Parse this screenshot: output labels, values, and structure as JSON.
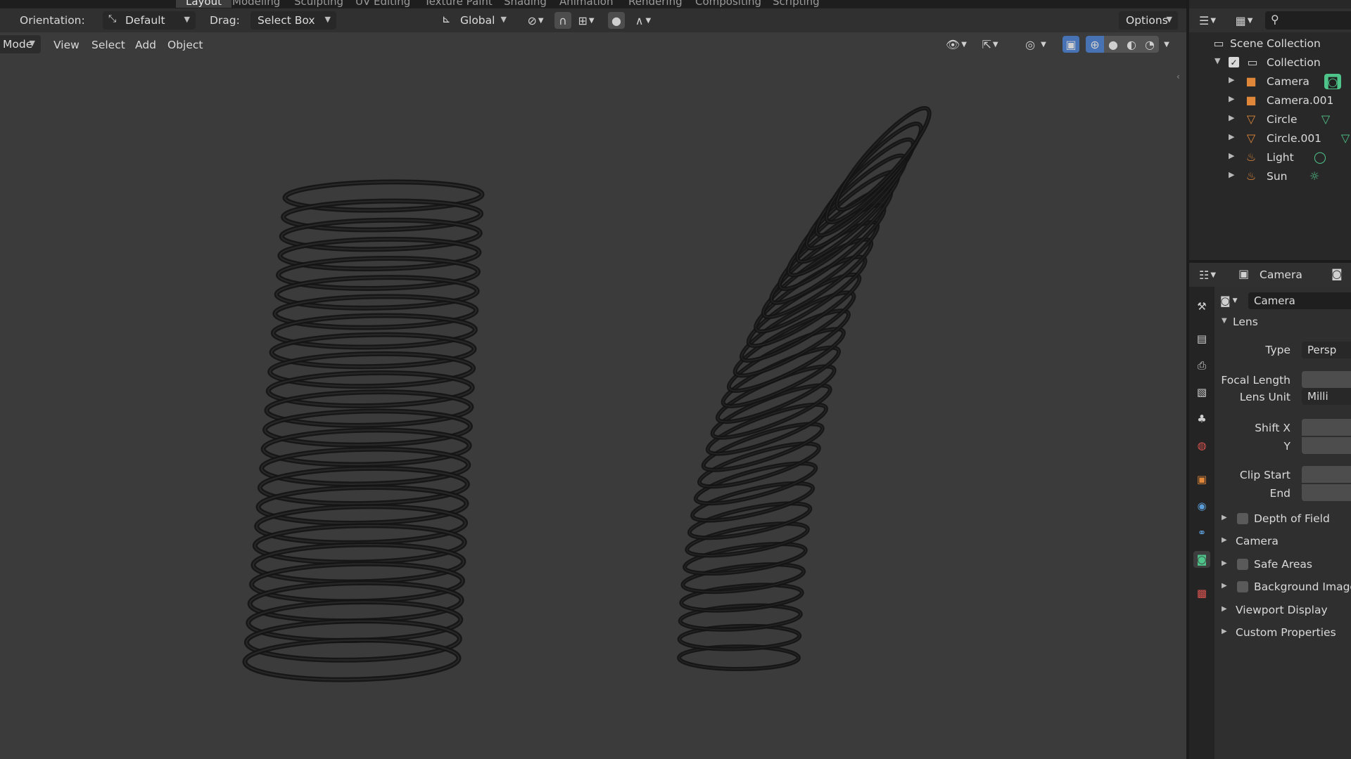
{
  "workspace_tabs": [
    "Layout",
    "Modeling",
    "Sculpting",
    "UV Editing",
    "Texture Paint",
    "Shading",
    "Animation",
    "Rendering",
    "Compositing",
    "Scripting"
  ],
  "tool_header": {
    "orientation_label": "Orientation:",
    "orientation_value": "Default",
    "drag_label": "Drag:",
    "drag_value": "Select Box",
    "transform_orientation": "Global",
    "options_label": "Options"
  },
  "viewport_header": {
    "mode_label": "Mode",
    "menus": [
      "View",
      "Select",
      "Add",
      "Object"
    ]
  },
  "outliner": {
    "root": "Scene Collection",
    "collection": "Collection",
    "items": [
      {
        "name": "Camera",
        "type": "camera"
      },
      {
        "name": "Camera.001",
        "type": "camera"
      },
      {
        "name": "Circle",
        "type": "curve"
      },
      {
        "name": "Circle.001",
        "type": "curve"
      },
      {
        "name": "Light",
        "type": "light"
      },
      {
        "name": "Sun",
        "type": "light"
      }
    ]
  },
  "properties": {
    "header_object": "Camera",
    "data_name": "Camera",
    "lens_section": "Lens",
    "fields": {
      "type_label": "Type",
      "type_value": "Persp",
      "focal_length_label": "Focal Length",
      "lens_unit_label": "Lens Unit",
      "lens_unit_value": "Milli",
      "shift_x_label": "Shift X",
      "shift_y_label": "Y",
      "clip_start_label": "Clip Start",
      "clip_end_label": "End"
    },
    "sections": [
      {
        "label": "Depth of Field",
        "checkbox": true
      },
      {
        "label": "Camera",
        "checkbox": false
      },
      {
        "label": "Safe Areas",
        "checkbox": true
      },
      {
        "label": "Background Images",
        "checkbox": true
      },
      {
        "label": "Viewport Display",
        "checkbox": false
      },
      {
        "label": "Custom Properties",
        "checkbox": false
      }
    ]
  },
  "colors": {
    "viewport_bg": "#3b3b3b",
    "camera_icon": "#e0873a",
    "curve_icon": "#e0873a",
    "data_green": "#4fc48a",
    "active_blue": "#4772b3"
  }
}
